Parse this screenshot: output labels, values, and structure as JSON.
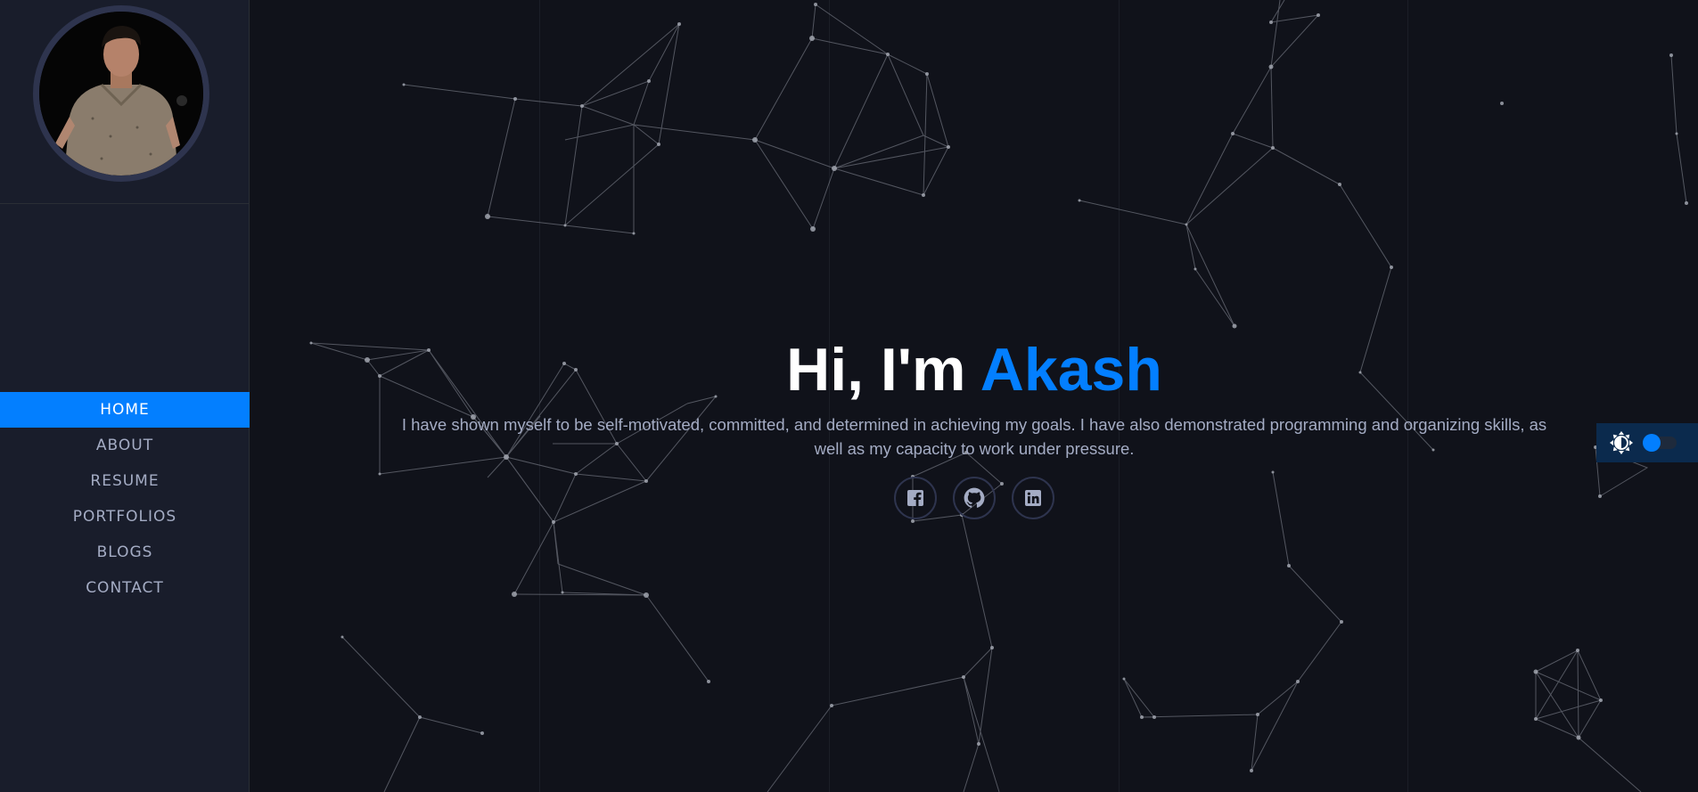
{
  "profile": {
    "avatar_label": "profile-photo"
  },
  "nav": {
    "items": [
      {
        "label": "HOME",
        "active": true
      },
      {
        "label": "ABOUT",
        "active": false
      },
      {
        "label": "RESUME",
        "active": false
      },
      {
        "label": "PORTFOLIOS",
        "active": false
      },
      {
        "label": "BLOGS",
        "active": false
      },
      {
        "label": "CONTACT",
        "active": false
      }
    ]
  },
  "hero": {
    "greeting": "Hi, I'm",
    "name": "Akash",
    "intro": "I have shown myself to be self-motivated, committed, and determined in achieving my goals. I have also demonstrated programming and organizing skills, as well as my capacity to work under pressure."
  },
  "socials": [
    {
      "icon": "facebook-icon"
    },
    {
      "icon": "github-icon"
    },
    {
      "icon": "linkedin-icon"
    }
  ],
  "theme": {
    "icon": "brightness-icon",
    "dark_mode": true
  },
  "colors": {
    "accent": "#037fff",
    "background": "#10121a",
    "sidebar": "#191d2b",
    "text_muted": "#a4acc4"
  }
}
